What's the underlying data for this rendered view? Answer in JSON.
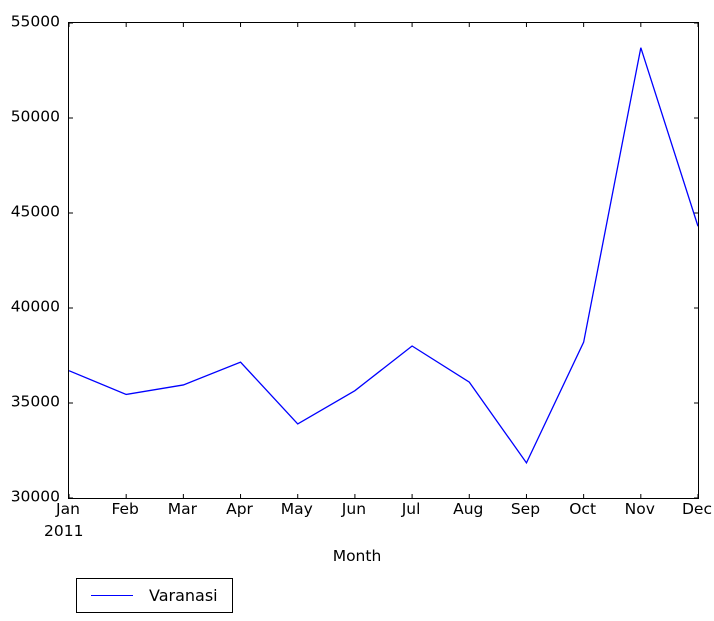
{
  "chart_data": {
    "type": "line",
    "title": "",
    "xlabel": "Month",
    "ylabel": "",
    "x_year": "2011",
    "categories": [
      "Jan",
      "Feb",
      "Mar",
      "Apr",
      "May",
      "Jun",
      "Jul",
      "Aug",
      "Sep",
      "Oct",
      "Nov",
      "Dec"
    ],
    "series": [
      {
        "name": "Varanasi",
        "color": "#0000ff",
        "values": [
          36700,
          35450,
          35950,
          37150,
          33900,
          35650,
          38000,
          36100,
          31850,
          38200,
          53700,
          44300
        ]
      }
    ],
    "ylim": [
      30000,
      55000
    ],
    "yticks": [
      30000,
      35000,
      40000,
      45000,
      50000,
      55000
    ],
    "ytick_labels": [
      "30000",
      "35000",
      "40000",
      "45000",
      "50000",
      "55000"
    ],
    "grid": false,
    "legend_position": "below-left",
    "legend_entries": [
      {
        "label": "Varanasi",
        "color": "#0000ff"
      }
    ]
  }
}
